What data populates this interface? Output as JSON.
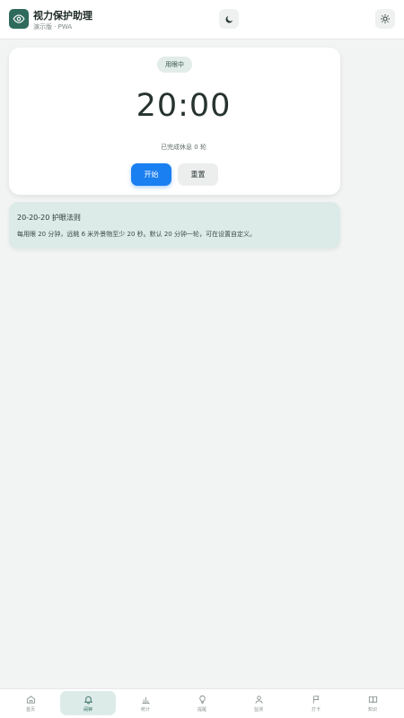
{
  "app": {
    "title": "视力保护助理",
    "subtitle": "演示版 · PWA"
  },
  "header": {
    "theme_toggle_icon": "moon-icon",
    "settings_icon": "sun-gear-icon"
  },
  "timer": {
    "status": "用眼中",
    "time": "20:00",
    "rounds_text": "已完成休息 0 轮",
    "start_label": "开始",
    "reset_label": "重置"
  },
  "rule": {
    "title": "20-20-20 护眼法则",
    "description": "每用眼 20 分钟，远眺 6 米外景物至少 20 秒。默认 20 分钟一轮，可在设置自定义。"
  },
  "nav": {
    "items": [
      {
        "label": "首页",
        "icon": "home-icon"
      },
      {
        "label": "闹钟",
        "icon": "bell-icon",
        "active": true
      },
      {
        "label": "统计",
        "icon": "bar-chart-icon"
      },
      {
        "label": "提醒",
        "icon": "lightbulb-icon"
      },
      {
        "label": "监测",
        "icon": "person-icon"
      },
      {
        "label": "打卡",
        "icon": "flag-icon"
      },
      {
        "label": "知识",
        "icon": "book-icon"
      }
    ]
  },
  "colors": {
    "accent": "#2f6b5d",
    "primary_button": "#1a7ff0",
    "background": "#f2f4f3",
    "rule_card": "#dcebe8"
  }
}
